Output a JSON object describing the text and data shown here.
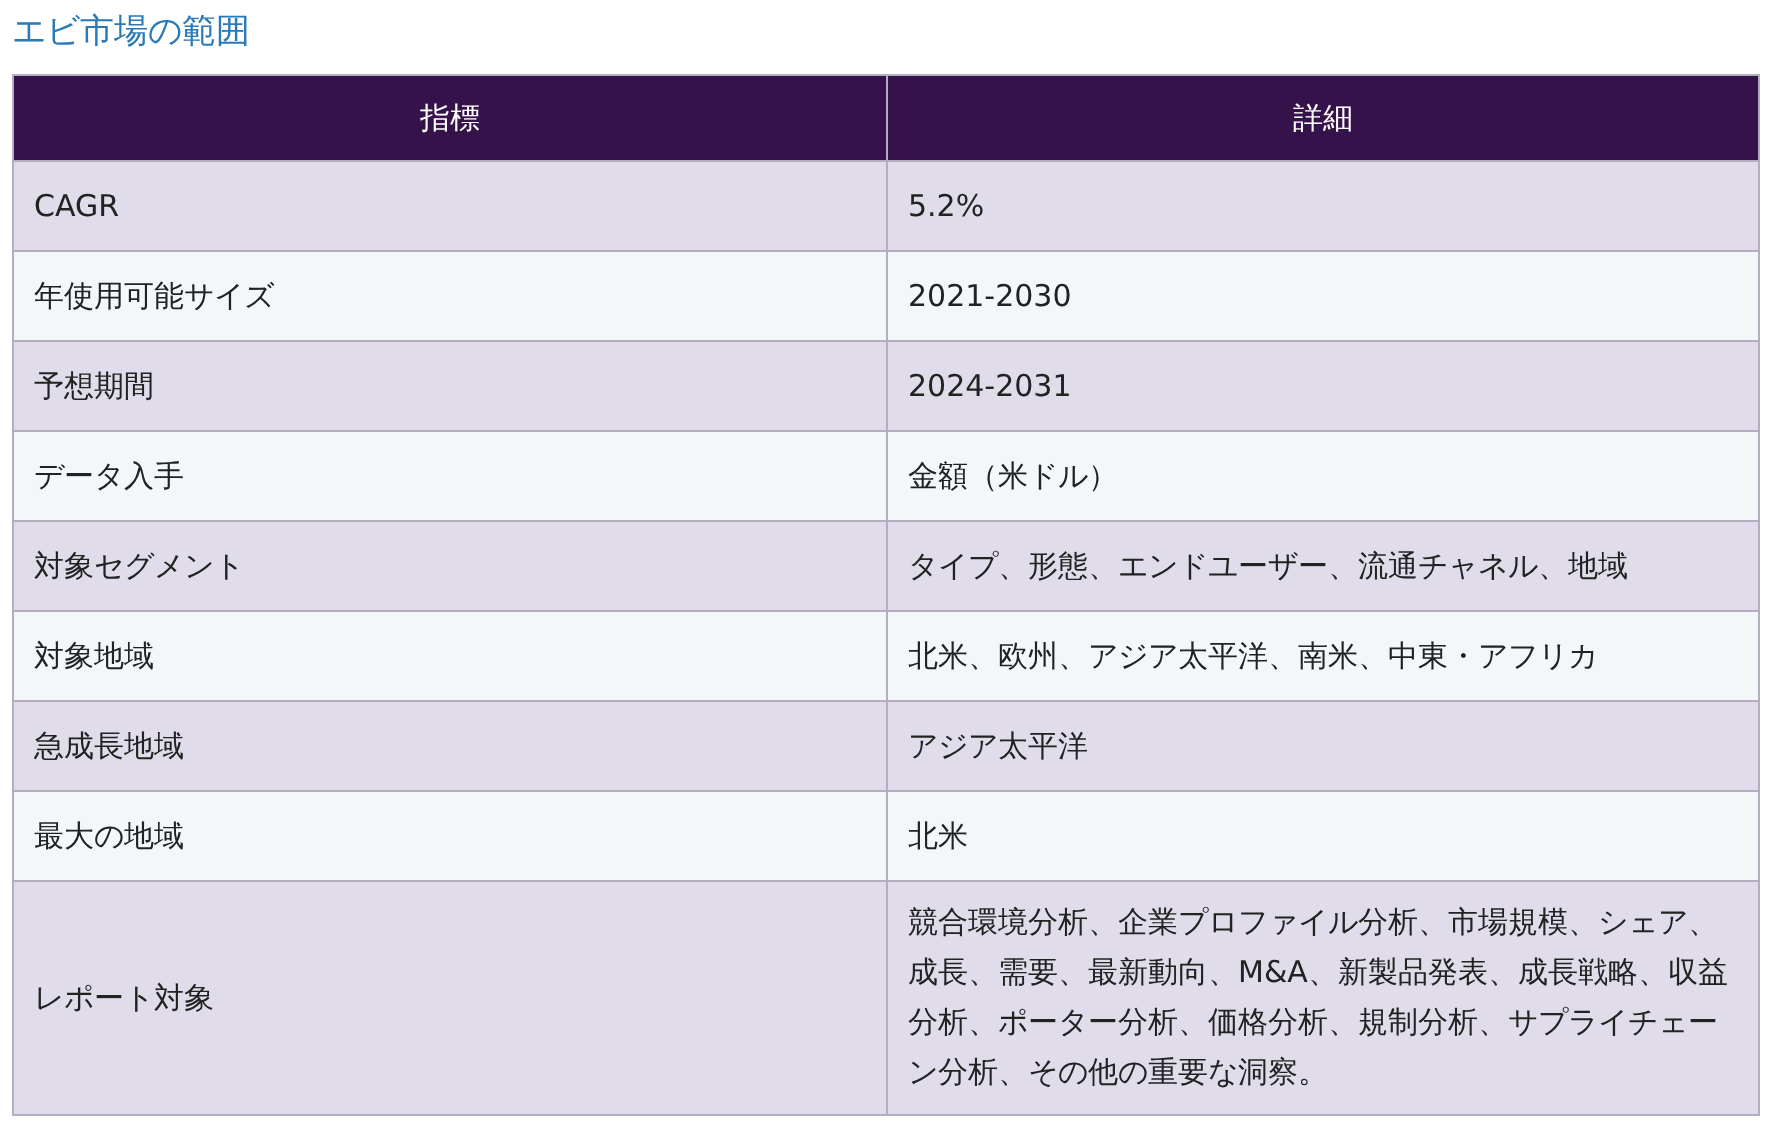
{
  "title": "エビ市場の範囲",
  "table": {
    "columns": [
      "指標",
      "詳細"
    ],
    "rows": [
      {
        "metric": "CAGR",
        "detail": "5.2%"
      },
      {
        "metric": "年使用可能サイズ",
        "detail": "2021-2030"
      },
      {
        "metric": "予想期間",
        "detail": "2024-2031"
      },
      {
        "metric": "データ入手",
        "detail": "金額（米ドル）"
      },
      {
        "metric": "対象セグメント",
        "detail": "タイプ、形態、エンドユーザー、流通チャネル、地域"
      },
      {
        "metric": "対象地域",
        "detail": "北米、欧州、アジア太平洋、南米、中東・アフリカ"
      },
      {
        "metric": "急成長地域",
        "detail": "アジア太平洋"
      },
      {
        "metric": "最大の地域",
        "detail": "北米"
      },
      {
        "metric": "レポート対象",
        "detail": "競合環境分析、企業プロファイル分析、市場規模、シェア、成長、需要、最新動向、M&A、新製品発表、成長戦略、収益分析、ポーター分析、価格分析、規制分析、サプライチェーン分析、その他の重要な洞察。"
      }
    ]
  }
}
